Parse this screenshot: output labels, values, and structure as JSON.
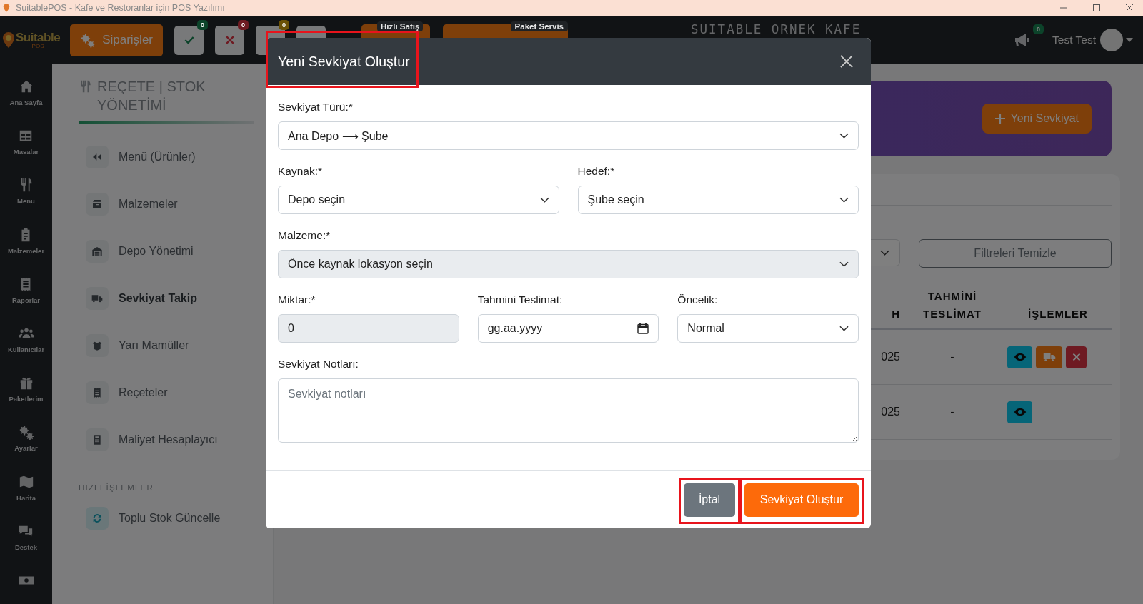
{
  "window": {
    "title": "SuitablePOS - Kafe ve Restoranlar için POS Yazılımı"
  },
  "top_bar": {
    "logo": {
      "name": "Suitable",
      "sub": "POS"
    },
    "orders_button": "Siparişler",
    "status_buttons": [
      {
        "kind": "check",
        "count": "0",
        "color": "#0c442a"
      },
      {
        "kind": "cross",
        "count": "0",
        "color": "#6e1b22"
      },
      {
        "kind": "blank",
        "count": "0",
        "color": "#6a5105"
      },
      {
        "kind": "blank"
      }
    ],
    "quick_sale": "Hızlı Satış",
    "delivery": "Paket Servis",
    "venue": "SUITABLE ORNEK KAFE",
    "announcements": {
      "count": "0"
    },
    "user": "Test Test"
  },
  "sidebar": {
    "items": [
      {
        "label": "Ana Sayfa"
      },
      {
        "label": "Masalar"
      },
      {
        "label": "Menu"
      },
      {
        "label": "Malzemeler"
      },
      {
        "label": "Raporlar"
      },
      {
        "label": "Kullanıcılar"
      },
      {
        "label": "Paketlerim"
      },
      {
        "label": "Ayarlar"
      },
      {
        "label": "Harita"
      },
      {
        "label": "Destek"
      }
    ]
  },
  "section_menu": {
    "title": "REÇETE | STOK YÖNETİMİ",
    "items": [
      {
        "label": "Menü (Ürünler)",
        "selected": false
      },
      {
        "label": "Malzemeler",
        "selected": false
      },
      {
        "label": "Depo Yönetimi",
        "selected": false
      },
      {
        "label": "Sevkiyat Takip",
        "selected": true
      },
      {
        "label": "Yarı Mamüller",
        "selected": false
      },
      {
        "label": "Reçeteler",
        "selected": false
      },
      {
        "label": "Maliyet Hesaplayıcı",
        "selected": false
      }
    ],
    "quick_title": "HIZLI İŞLEMLER",
    "quick_items": [
      {
        "label": "Toplu Stok Güncelle"
      }
    ]
  },
  "main": {
    "new_button": "Yeni Sevkiyat",
    "clear_filters": "Filtreleri Temizle",
    "table": {
      "columns": [
        "H",
        "TAHMİNİ TESLİMAT",
        "İŞLEMLER"
      ],
      "rows": [
        {
          "cells": [
            "025",
            "-"
          ],
          "actions": [
            {
              "kind": "view"
            },
            {
              "kind": "ship"
            },
            {
              "kind": "cancel"
            }
          ]
        },
        {
          "cells": [
            "025",
            "-"
          ],
          "actions": [
            {
              "kind": "view"
            }
          ]
        }
      ]
    }
  },
  "modal": {
    "title": "Yeni Sevkiyat Oluştur",
    "title_highlighted": true,
    "rows": [
      [
        {
          "kind": "select",
          "label": "Sevkiyat Türü:*",
          "value": "Ana Depo ⟶ Şube",
          "disabled": false
        }
      ],
      [
        {
          "kind": "select",
          "label": "Kaynak:*",
          "value": "Depo seçin",
          "disabled": false
        },
        {
          "kind": "select",
          "label": "Hedef:*",
          "value": "Şube seçin",
          "disabled": false
        }
      ],
      [
        {
          "kind": "select",
          "label": "Malzeme:*",
          "value": "Önce kaynak lokasyon seçin",
          "disabled": true
        }
      ],
      [
        {
          "kind": "input",
          "label": "Miktar:*",
          "value": "0",
          "disabled": true
        },
        {
          "kind": "date",
          "label": "Tahmini Teslimat:",
          "placeholder": "gg.aa.yyyy",
          "disabled": false
        },
        {
          "kind": "select",
          "label": "Öncelik:",
          "value": "Normal",
          "disabled": false
        }
      ],
      [
        {
          "kind": "textarea",
          "label": "Sevkiyat Notları:",
          "placeholder": "Sevkiyat notları",
          "disabled": false
        }
      ]
    ],
    "buttons": [
      {
        "kind": "secondary",
        "label": "İptal",
        "highlighted": true
      },
      {
        "kind": "primary",
        "label": "Sevkiyat Oluştur",
        "highlighted": true
      }
    ]
  }
}
